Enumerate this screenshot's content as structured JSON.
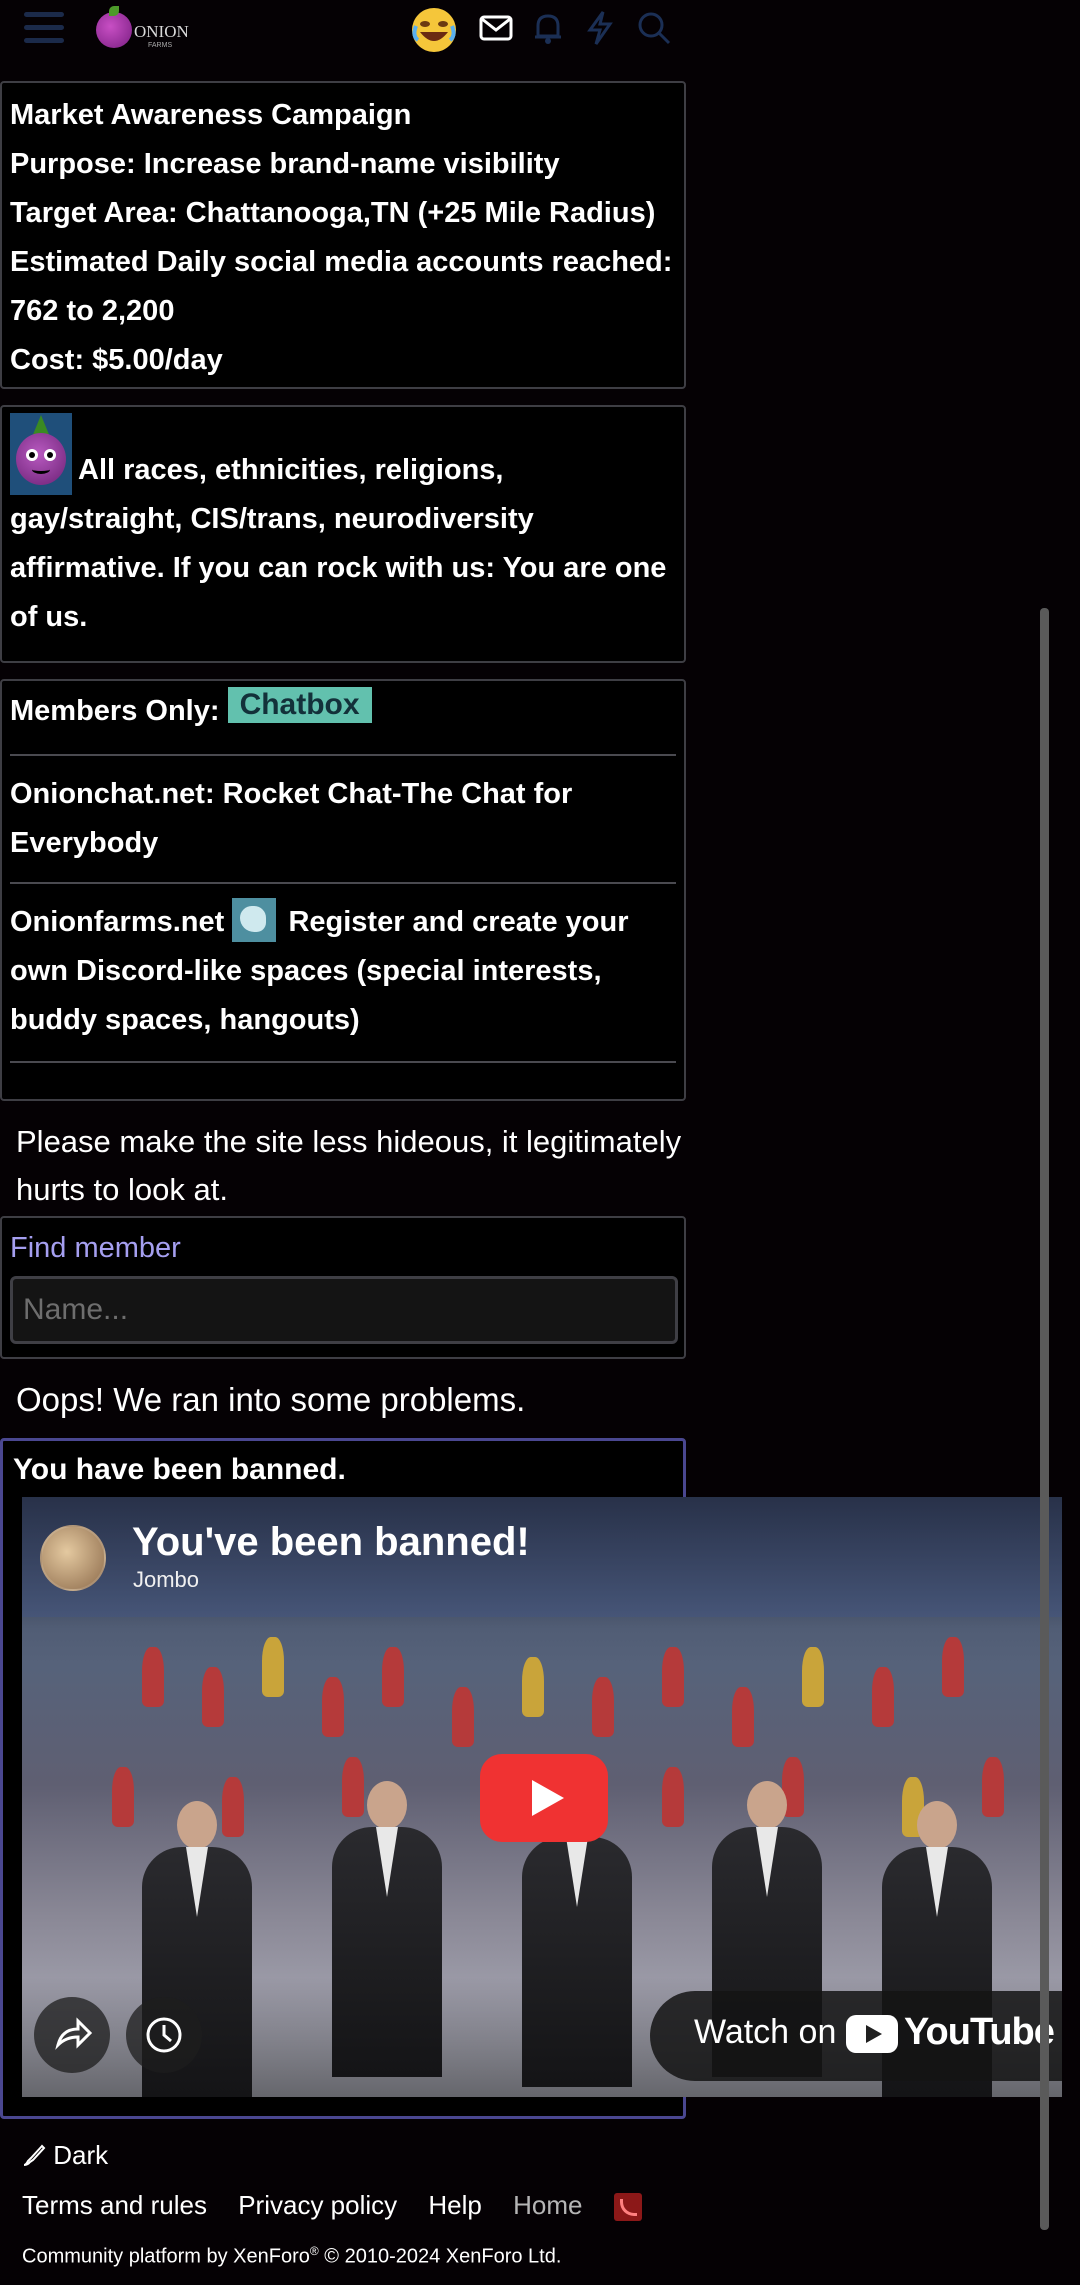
{
  "header": {
    "brand_name": "ONION",
    "brand_sub": "FARMS",
    "icons": [
      "menu-icon",
      "emoji-reaction-icon",
      "envelope-icon",
      "bell-icon",
      "lightning-icon",
      "search-icon"
    ]
  },
  "campaign": {
    "lines": [
      "Market Awareness Campaign",
      "Purpose: Increase brand-name visibility",
      "Target Area: Chattanooga,TN (+25 Mile Radius)",
      "Estimated Daily social media accounts reached:",
      "762 to 2,200",
      "Cost: $5.00/day"
    ]
  },
  "inclusive": {
    "text": "All races, ethnicities, religions, gay/straight, CIS/trans, neurodiversity affirmative. If you can rock with us: You are one of us."
  },
  "members": {
    "prefix": "Members Only:",
    "chatbox_label": "Chatbox",
    "onionchat": "Onionchat.net: Rocket Chat-The Chat for Everybody",
    "onionfarms_link": "Onionfarms.net",
    "onionfarms_rest": "Register and create your own Discord-like spaces (special interests, buddy spaces, hangouts)"
  },
  "notice": "Please make the site less hideous, it legitimately hurts to look at.",
  "find_member": {
    "title": "Find member",
    "placeholder": "Name..."
  },
  "oops": "Oops! We ran into some problems.",
  "banned": {
    "title": "You have been banned.",
    "video": {
      "title": "You've been banned!",
      "channel": "Jombo",
      "watch_on": "Watch on",
      "youtube": "YouTube"
    }
  },
  "footer": {
    "style_toggle": "Dark",
    "links": [
      "Terms and rules",
      "Privacy policy",
      "Help",
      "Home"
    ],
    "copyright_prefix": "Community platform by XenForo",
    "copyright_suffix": " © 2010-2024 XenForo Ltd."
  },
  "colors": {
    "background": "#050104",
    "find_member_title": "#a59ff0",
    "chatbox": "#62c1ae",
    "youtube_red": "#f03232",
    "banned_border": "#4a4790"
  }
}
